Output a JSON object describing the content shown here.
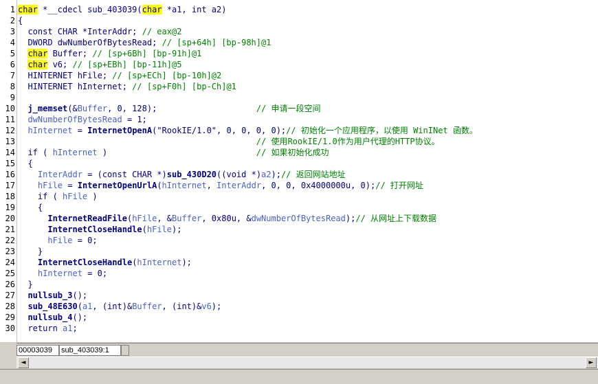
{
  "editor": {
    "lines": [
      {
        "n": "1",
        "parts": [
          [
            "hl",
            "char"
          ],
          [
            "plain",
            " *__cdecl sub_403039("
          ],
          [
            "hl",
            "char"
          ],
          [
            "plain",
            " *a1, int a2)"
          ]
        ]
      },
      {
        "n": "2",
        "parts": [
          [
            "plain",
            "{"
          ]
        ]
      },
      {
        "n": "3",
        "parts": [
          [
            "plain",
            "  const CHAR *InterAddr; "
          ],
          [
            "cmt",
            "// eax@2"
          ]
        ]
      },
      {
        "n": "4",
        "parts": [
          [
            "plain",
            "  DWORD dwNumberOfBytesRead; "
          ],
          [
            "cmt",
            "// [sp+64h] [bp-98h]@1"
          ]
        ]
      },
      {
        "n": "5",
        "parts": [
          [
            "plain",
            "  "
          ],
          [
            "hl",
            "char"
          ],
          [
            "plain",
            " Buffer; "
          ],
          [
            "cmt",
            "// [sp+6Bh] [bp-91h]@1"
          ]
        ]
      },
      {
        "n": "6",
        "parts": [
          [
            "plain",
            "  "
          ],
          [
            "hl",
            "char"
          ],
          [
            "plain",
            " v6; "
          ],
          [
            "cmt",
            "// [sp+EBh] [bp-11h]@5"
          ]
        ]
      },
      {
        "n": "7",
        "parts": [
          [
            "plain",
            "  HINTERNET hFile; "
          ],
          [
            "cmt",
            "// [sp+ECh] [bp-10h]@2"
          ]
        ]
      },
      {
        "n": "8",
        "parts": [
          [
            "plain",
            "  HINTERNET hInternet; "
          ],
          [
            "cmt",
            "// [sp+F0h] [bp-Ch]@1"
          ]
        ]
      },
      {
        "n": "9",
        "parts": [
          [
            "plain",
            ""
          ]
        ]
      },
      {
        "n": "10",
        "parts": [
          [
            "plain",
            "  "
          ],
          [
            "fn",
            "j_memset"
          ],
          [
            "plain",
            "(&"
          ],
          [
            "var",
            "Buffer"
          ],
          [
            "plain",
            ", 0, 128);                    "
          ],
          [
            "cmt",
            "// 申请一段空间"
          ]
        ]
      },
      {
        "n": "11",
        "parts": [
          [
            "plain",
            "  "
          ],
          [
            "var",
            "dwNumberOfBytesRead"
          ],
          [
            "plain",
            " = 1;"
          ]
        ]
      },
      {
        "n": "12",
        "parts": [
          [
            "plain",
            "  "
          ],
          [
            "var",
            "hInternet"
          ],
          [
            "plain",
            " = "
          ],
          [
            "fn",
            "InternetOpenA"
          ],
          [
            "plain",
            "(\"RookIE/1.0\", 0, 0, 0, 0);"
          ],
          [
            "cmt",
            "// 初始化一个应用程序，以使用 WinINet 函数。"
          ]
        ]
      },
      {
        "n": "13",
        "parts": [
          [
            "plain",
            "                                                "
          ],
          [
            "cmt",
            "// 使用RookIE/1.0作为用户代理的HTTP协议。"
          ]
        ]
      },
      {
        "n": "14",
        "parts": [
          [
            "plain",
            "  if ( "
          ],
          [
            "var",
            "hInternet"
          ],
          [
            "plain",
            " )                              "
          ],
          [
            "cmt",
            "// 如果初始化成功"
          ]
        ]
      },
      {
        "n": "15",
        "parts": [
          [
            "plain",
            "  {"
          ]
        ]
      },
      {
        "n": "16",
        "parts": [
          [
            "plain",
            "    "
          ],
          [
            "var",
            "InterAddr"
          ],
          [
            "plain",
            " = (const CHAR *)"
          ],
          [
            "fn",
            "sub_430D20"
          ],
          [
            "plain",
            "((void *)"
          ],
          [
            "var",
            "a2"
          ],
          [
            "plain",
            ");"
          ],
          [
            "cmt",
            "// 返回网站地址"
          ]
        ]
      },
      {
        "n": "17",
        "parts": [
          [
            "plain",
            "    "
          ],
          [
            "var",
            "hFile"
          ],
          [
            "plain",
            " = "
          ],
          [
            "fn",
            "InternetOpenUrlA"
          ],
          [
            "plain",
            "("
          ],
          [
            "var",
            "hInternet"
          ],
          [
            "plain",
            ", "
          ],
          [
            "var",
            "InterAddr"
          ],
          [
            "plain",
            ", 0, 0, 0x4000000u, 0);"
          ],
          [
            "cmt",
            "// 打开网址"
          ]
        ]
      },
      {
        "n": "18",
        "parts": [
          [
            "plain",
            "    if ( "
          ],
          [
            "var",
            "hFile"
          ],
          [
            "plain",
            " )"
          ]
        ]
      },
      {
        "n": "19",
        "parts": [
          [
            "plain",
            "    {"
          ]
        ]
      },
      {
        "n": "20",
        "parts": [
          [
            "plain",
            "      "
          ],
          [
            "fn",
            "InternetReadFile"
          ],
          [
            "plain",
            "("
          ],
          [
            "var",
            "hFile"
          ],
          [
            "plain",
            ", &"
          ],
          [
            "var",
            "Buffer"
          ],
          [
            "plain",
            ", 0x80u, &"
          ],
          [
            "var",
            "dwNumberOfBytesRead"
          ],
          [
            "plain",
            ");"
          ],
          [
            "cmt",
            "// 从网址上下载数据"
          ]
        ]
      },
      {
        "n": "21",
        "parts": [
          [
            "plain",
            "      "
          ],
          [
            "fn",
            "InternetCloseHandle"
          ],
          [
            "plain",
            "("
          ],
          [
            "var",
            "hFile"
          ],
          [
            "plain",
            ");"
          ]
        ]
      },
      {
        "n": "22",
        "parts": [
          [
            "plain",
            "      "
          ],
          [
            "var",
            "hFile"
          ],
          [
            "plain",
            " = 0;"
          ]
        ]
      },
      {
        "n": "23",
        "parts": [
          [
            "plain",
            "    }"
          ]
        ]
      },
      {
        "n": "24",
        "parts": [
          [
            "plain",
            "    "
          ],
          [
            "fn",
            "InternetCloseHandle"
          ],
          [
            "plain",
            "("
          ],
          [
            "var",
            "hInternet"
          ],
          [
            "plain",
            ");"
          ]
        ]
      },
      {
        "n": "25",
        "parts": [
          [
            "plain",
            "    "
          ],
          [
            "var",
            "hInternet"
          ],
          [
            "plain",
            " = 0;"
          ]
        ]
      },
      {
        "n": "26",
        "parts": [
          [
            "plain",
            "  }"
          ]
        ]
      },
      {
        "n": "27",
        "parts": [
          [
            "plain",
            "  "
          ],
          [
            "fn",
            "nullsub_3"
          ],
          [
            "plain",
            "();"
          ]
        ]
      },
      {
        "n": "28",
        "parts": [
          [
            "plain",
            "  "
          ],
          [
            "fn",
            "sub_48E630"
          ],
          [
            "plain",
            "("
          ],
          [
            "var",
            "a1"
          ],
          [
            "plain",
            ", (int)&"
          ],
          [
            "var",
            "Buffer"
          ],
          [
            "plain",
            ", (int)&"
          ],
          [
            "var",
            "v6"
          ],
          [
            "plain",
            ");"
          ]
        ]
      },
      {
        "n": "29",
        "parts": [
          [
            "plain",
            "  "
          ],
          [
            "fn",
            "nullsub_4"
          ],
          [
            "plain",
            "();"
          ]
        ]
      },
      {
        "n": "30",
        "parts": [
          [
            "plain",
            "  return "
          ],
          [
            "var",
            "a1"
          ],
          [
            "plain",
            ";"
          ]
        ]
      }
    ]
  },
  "status": {
    "address": "00003039",
    "location": "sub_403039:1"
  },
  "scrollbar": {
    "left_arrow": "◄",
    "right_arrow": "►"
  }
}
